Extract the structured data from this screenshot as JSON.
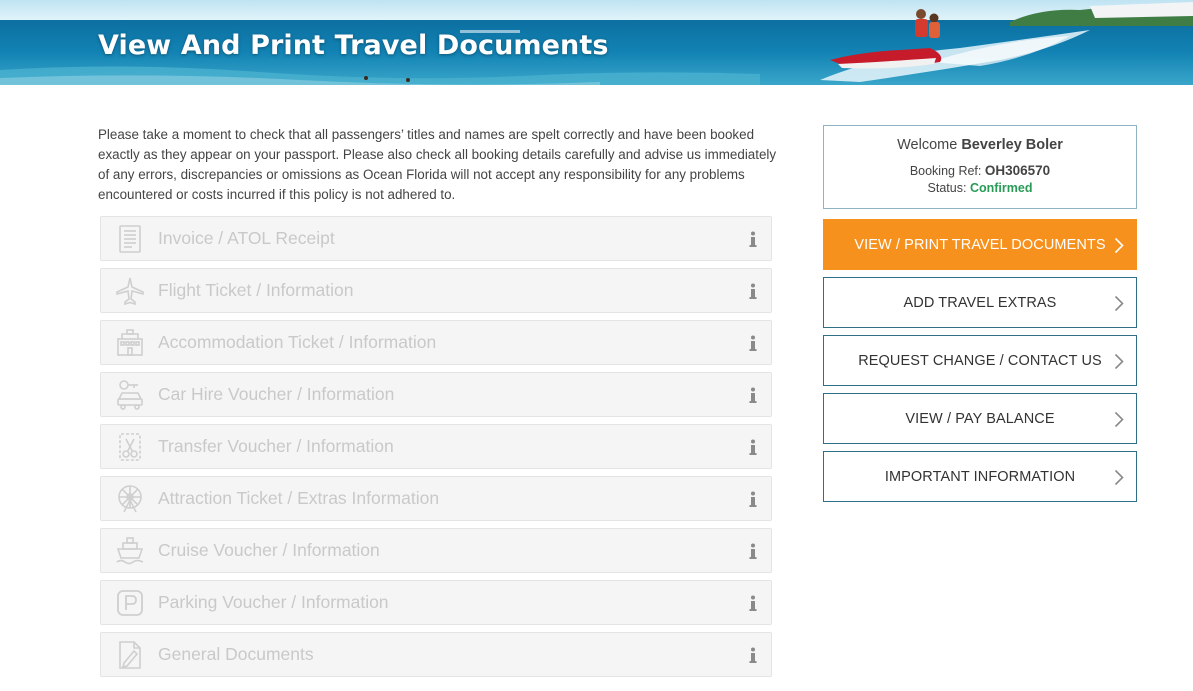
{
  "header": {
    "title": "View And Print Travel Documents"
  },
  "intro": {
    "text": "Please take a moment to check that all passengers’ titles and names are spelt correctly and have been booked exactly as they appear on your passport. Please also check all booking details carefully and advise us immediately of any errors, discrepancies or omissions as Ocean Florida will not accept any responsibility for any problems encountered or costs incurred if this policy is not adhered to."
  },
  "documents": [
    {
      "label": "Invoice / ATOL Receipt",
      "icon": "invoice-icon"
    },
    {
      "label": "Flight Ticket / Information",
      "icon": "plane-icon"
    },
    {
      "label": "Accommodation Ticket / Information",
      "icon": "hotel-icon"
    },
    {
      "label": "Car Hire Voucher / Information",
      "icon": "car-icon"
    },
    {
      "label": "Transfer Voucher / Information",
      "icon": "scissors-voucher-icon"
    },
    {
      "label": "Attraction Ticket / Extras Information",
      "icon": "ferris-wheel-icon"
    },
    {
      "label": "Cruise Voucher / Information",
      "icon": "ship-icon"
    },
    {
      "label": "Parking Voucher / Information",
      "icon": "parking-icon"
    },
    {
      "label": "General Documents",
      "icon": "document-pen-icon"
    }
  ],
  "account": {
    "welcome_prefix": "Welcome",
    "name": "Beverley Boler",
    "ref_label": "Booking Ref:",
    "ref_value": "OH306570",
    "status_label": "Status:",
    "status_value": "Confirmed"
  },
  "menu": [
    {
      "label": "VIEW / PRINT TRAVEL DOCUMENTS",
      "active": true
    },
    {
      "label": "ADD TRAVEL EXTRAS",
      "active": false
    },
    {
      "label": "REQUEST CHANGE / CONTACT US",
      "active": false
    },
    {
      "label": "VIEW / PAY BALANCE",
      "active": false
    },
    {
      "label": "IMPORTANT INFORMATION",
      "active": false
    }
  ],
  "colors": {
    "accent_orange": "#f7911e",
    "button_border": "#2f6f87",
    "status_green": "#2a9a57",
    "muted_text": "#c9c9c9"
  }
}
